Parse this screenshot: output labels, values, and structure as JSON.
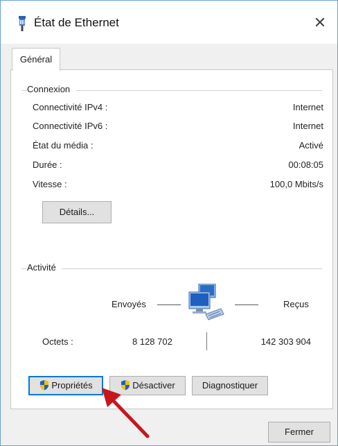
{
  "window": {
    "title": "État de Ethernet",
    "close_glyph": "✕"
  },
  "tabs": [
    {
      "label": "Général"
    }
  ],
  "connexion": {
    "header": "Connexion",
    "rows": [
      {
        "label": "Connectivité IPv4 :",
        "value": "Internet"
      },
      {
        "label": "Connectivité IPv6 :",
        "value": "Internet"
      },
      {
        "label": "État du média :",
        "value": "Activé"
      },
      {
        "label": "Durée :",
        "value": "00:08:05"
      },
      {
        "label": "Vitesse :",
        "value": "100,0 Mbits/s"
      }
    ],
    "details_button": "Détails..."
  },
  "activite": {
    "header": "Activité",
    "sent_label": "Envoyés",
    "received_label": "Reçus",
    "bytes_label": "Octets :",
    "bytes_sent": "8 128 702",
    "bytes_received": "142 303 904"
  },
  "actions": {
    "properties": "Propriétés",
    "disable": "Désactiver",
    "diagnose": "Diagnostiquer"
  },
  "footer": {
    "close_button": "Fermer"
  },
  "icons": {
    "title": "ethernet-plug-icon",
    "shield": "uac-shield-icon",
    "network": "network-activity-icon",
    "annotation": "red-arrow-annotation"
  },
  "colors": {
    "arrow": "#c8161d",
    "window_border": "#6aa0d6",
    "focus": "#0078d7"
  }
}
